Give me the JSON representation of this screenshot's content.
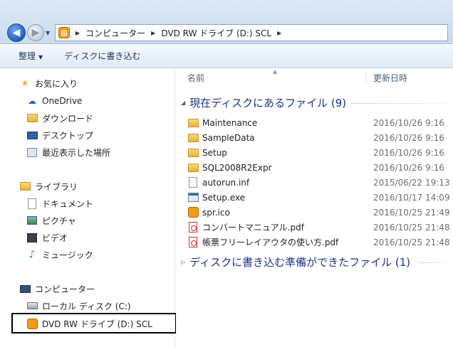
{
  "address": {
    "crumbs": [
      "コンピューター",
      "DVD RW ドライブ (D:) SCL"
    ],
    "sep": "▶"
  },
  "toolbar": {
    "organize_label": "整理",
    "burn_label": "ディスクに書き込む"
  },
  "nav": {
    "favorites_label": "お気に入り",
    "favorites": [
      "OneDrive",
      "ダウンロード",
      "デスクトップ",
      "最近表示した場所"
    ],
    "libraries_label": "ライブラリ",
    "libraries": [
      "ドキュメント",
      "ピクチャ",
      "ビデオ",
      "ミュージック"
    ],
    "computer_label": "コンピューター",
    "drives": [
      "ローカル ディスク (C:)",
      "DVD RW ドライブ (D:) SCL"
    ]
  },
  "columns": {
    "name": "名前",
    "date": "更新日時"
  },
  "groups": {
    "current_label": "現在ディスクにあるファイル (9)",
    "pending_label": "ディスクに書き込む準備ができたファイル (1)"
  },
  "files": [
    {
      "name": "Maintenance",
      "date": "2016/10/26 9:16",
      "icon": "folder-icon"
    },
    {
      "name": "SampleData",
      "date": "2016/10/26 9:16",
      "icon": "folder-icon"
    },
    {
      "name": "Setup",
      "date": "2016/10/26 9:16",
      "icon": "folder-icon"
    },
    {
      "name": "SQL2008R2Expr",
      "date": "2016/10/26 9:16",
      "icon": "folder-icon"
    },
    {
      "name": "autorun.inf",
      "date": "2015/06/22 19:13",
      "icon": "settings-file-icon"
    },
    {
      "name": "Setup.exe",
      "date": "2016/10/17 14:09",
      "icon": "exe-icon"
    },
    {
      "name": "spr.ico",
      "date": "2016/10/25 21:49",
      "icon": "ico-file-icon"
    },
    {
      "name": "コンバートマニュアル.pdf",
      "date": "2016/10/25 21:48",
      "icon": "pdf-icon"
    },
    {
      "name": "帳票フリーレイアウタの使い方.pdf",
      "date": "2016/10/25 21:48",
      "icon": "pdf-icon"
    }
  ]
}
